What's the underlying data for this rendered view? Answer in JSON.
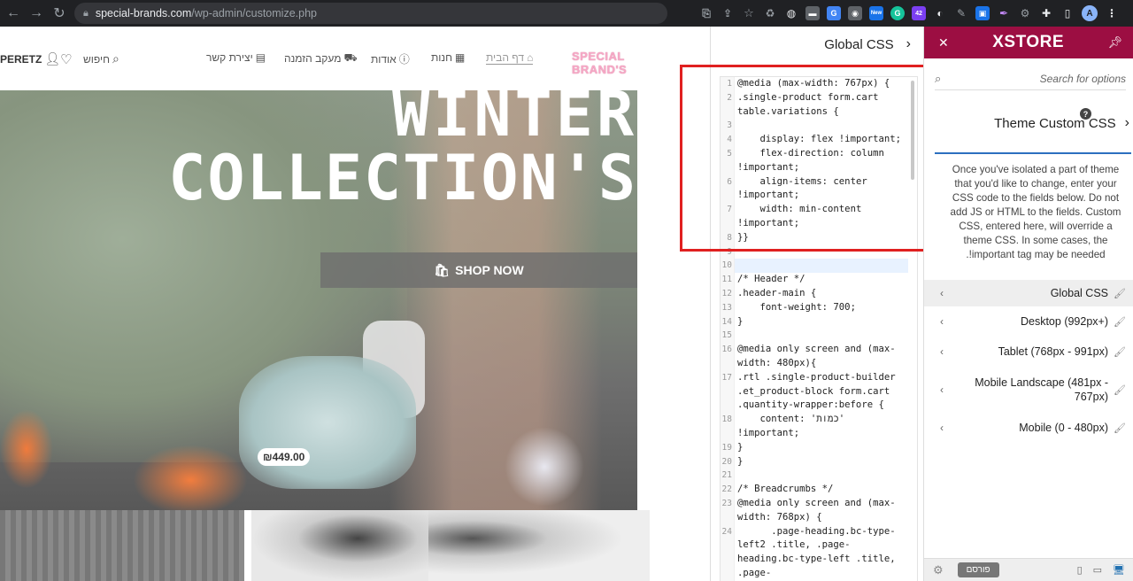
{
  "browser": {
    "url_host": "special-brands.com",
    "url_path": "/wp-admin/customize.php",
    "avatar_letter": "A",
    "ext_badge_new": "New",
    "ext_badge_count": "42"
  },
  "site": {
    "logo_text": "SPECIAL BRAND'S",
    "nav": {
      "home": "דף הבית",
      "shop": "חנות",
      "about": "אודות",
      "tracking": "מעקב הזמנה",
      "contact": "יצירת קשר",
      "search": "חיפוש",
      "user": "PERETZ"
    },
    "hero_line1": "WINTER",
    "hero_line2": "COLLECTION'S",
    "shop_now": "SHOP NOW",
    "price": "₪449.00"
  },
  "code_panel": {
    "title": "Global CSS",
    "lines": [
      {
        "n": "1",
        "t": "@media (max-width: 767px) {"
      },
      {
        "n": "2",
        "t": ".single-product form.cart table.variations {"
      },
      {
        "n": "3",
        "t": ""
      },
      {
        "n": "4",
        "t": "    display: flex !important;"
      },
      {
        "n": "5",
        "t": "    flex-direction: column !important;"
      },
      {
        "n": "6",
        "t": "    align-items: center !important;"
      },
      {
        "n": "7",
        "t": "    width: min-content !important;"
      },
      {
        "n": "8",
        "t": "}}"
      },
      {
        "n": "9",
        "t": ""
      },
      {
        "n": "10",
        "t": ""
      },
      {
        "n": "11",
        "t": "/* Header */"
      },
      {
        "n": "12",
        "t": ".header-main {"
      },
      {
        "n": "13",
        "t": "    font-weight: 700;"
      },
      {
        "n": "14",
        "t": "}"
      },
      {
        "n": "15",
        "t": ""
      },
      {
        "n": "16",
        "t": "@media only screen and (max-width: 480px){"
      },
      {
        "n": "17",
        "t": ".rtl .single-product-builder .et_product-block form.cart .quantity-wrapper:before {"
      },
      {
        "n": "18",
        "t": "    content: 'כמות' !important;"
      },
      {
        "n": "19",
        "t": "}"
      },
      {
        "n": "20",
        "t": "}"
      },
      {
        "n": "21",
        "t": ""
      },
      {
        "n": "22",
        "t": "/* Breadcrumbs */"
      },
      {
        "n": "23",
        "t": "@media only screen and (max-width: 768px) {"
      },
      {
        "n": "24",
        "t": "      .page-heading.bc-type-left2 .title, .page-heading.bc-type-left .title, .page-"
      }
    ]
  },
  "xstore": {
    "logo": "XSTORE",
    "search_placeholder": "Search for options",
    "section_title": "Theme Custom CSS",
    "description": "Once you've isolated a part of theme that you'd like to change, enter your CSS code to the fields below. Do not add JS or HTML to the fields. Custom CSS, entered here, will override a theme CSS. In some cases, the !important tag may be needed.",
    "items": [
      {
        "label": "Global CSS",
        "active": true
      },
      {
        "label": "Desktop (992px+)"
      },
      {
        "label": "Tablet (768px - 991px)"
      },
      {
        "label": "Mobile Landscape (481px - 767px)"
      },
      {
        "label": "Mobile (0 - 480px)"
      }
    ],
    "publish": "פורסם"
  }
}
